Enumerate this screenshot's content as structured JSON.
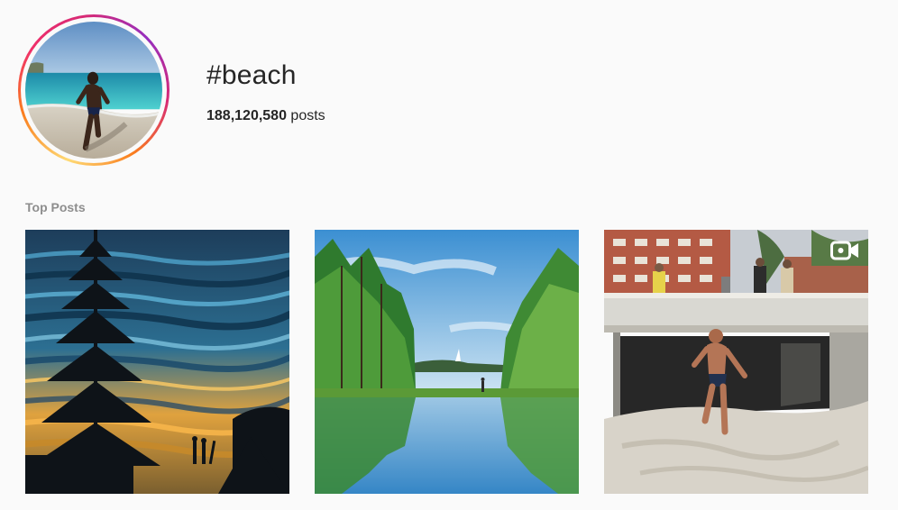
{
  "header": {
    "hashtag": "#beach",
    "post_count": "188,120,580",
    "post_count_suffix": " posts",
    "avatar_icon": "beach-runner-photo"
  },
  "sections": {
    "top_posts_label": "Top Posts"
  },
  "posts": [
    {
      "icon": "sunset-ocean-tree-photo",
      "is_video": false
    },
    {
      "icon": "forest-lake-reflection-photo",
      "is_video": false
    },
    {
      "icon": "man-running-on-sand-photo",
      "is_video": true,
      "overlay_icon": "video-camera-icon"
    }
  ],
  "colors": {
    "background": "#fafafa",
    "text": "#262626",
    "muted": "#8e8e8e",
    "ring_gradient": [
      "#feda75",
      "#fa7e1e",
      "#d62976",
      "#962fbf"
    ]
  }
}
